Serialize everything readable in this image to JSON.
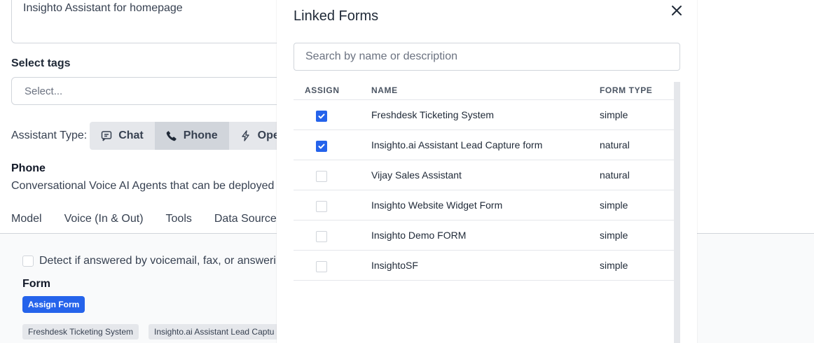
{
  "background": {
    "description_value": "Insighto Assistant for homepage",
    "select_tags_label": "Select tags",
    "tags_placeholder": "Select...",
    "assistant_type_label": "Assistant Type:",
    "assistant_types": [
      {
        "label": "Chat",
        "icon": "chat-icon"
      },
      {
        "label": "Phone",
        "icon": "phone-icon",
        "active": true
      },
      {
        "label": "Open",
        "icon": "bolt-icon"
      }
    ],
    "phone_title": "Phone",
    "phone_description": "Conversational Voice AI Agents that can be deployed o",
    "tabs": [
      "Model",
      "Voice (In & Out)",
      "Tools",
      "Data Sources"
    ],
    "detect_label": "Detect if answered by voicemail, fax, or answerin",
    "form_label": "Form",
    "assign_form_button": "Assign Form",
    "assigned_chips": [
      "Freshdesk Ticketing System",
      "Insighto.ai Assistant Lead Captu"
    ]
  },
  "modal": {
    "title": "Linked Forms",
    "search_placeholder": "Search by name or description",
    "columns": {
      "assign": "ASSIGN",
      "name": "NAME",
      "form_type": "FORM TYPE"
    },
    "rows": [
      {
        "name": "Freshdesk Ticketing System",
        "type": "simple",
        "assigned": true
      },
      {
        "name": "Insighto.ai Assistant Lead Capture form",
        "type": "natural",
        "assigned": true
      },
      {
        "name": "Vijay Sales Assistant",
        "type": "natural",
        "assigned": false
      },
      {
        "name": "Insighto Website Widget Form",
        "type": "simple",
        "assigned": false
      },
      {
        "name": "Insighto Demo FORM",
        "type": "simple",
        "assigned": false
      },
      {
        "name": "InsightoSF",
        "type": "simple",
        "assigned": false
      }
    ]
  },
  "colors": {
    "accent": "#2563eb",
    "border": "#d1d5db"
  }
}
